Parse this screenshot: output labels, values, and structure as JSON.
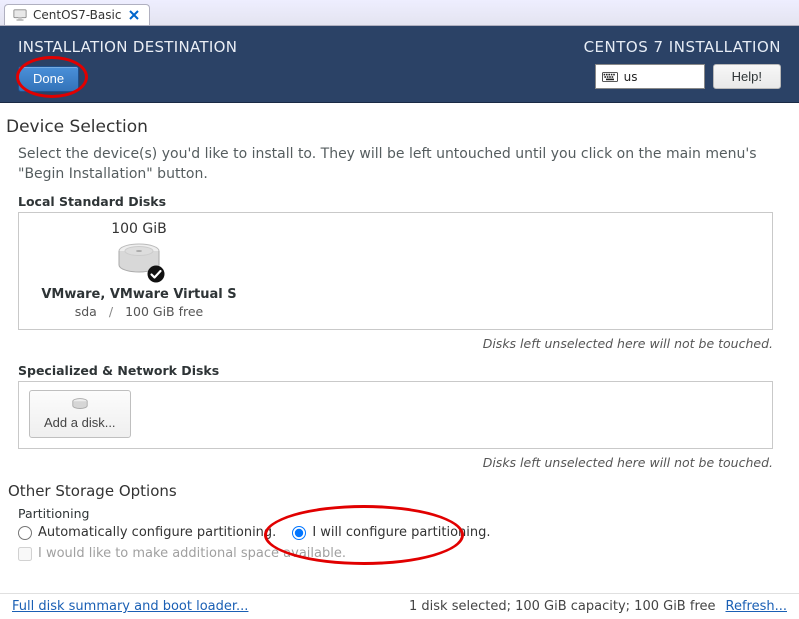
{
  "tab": {
    "title": "CentOS7-Basic"
  },
  "header": {
    "title": "INSTALLATION DESTINATION",
    "done_label": "Done",
    "subtitle": "CENTOS 7 INSTALLATION",
    "keyboard_layout": "us",
    "help_label": "Help!"
  },
  "device_selection": {
    "heading": "Device Selection",
    "intro": "Select the device(s) you'd like to install to.  They will be left untouched until you click on the main menu's \"Begin Installation\" button."
  },
  "local_disks": {
    "label": "Local Standard Disks",
    "disk": {
      "size": "100 GiB",
      "name": "VMware, VMware Virtual S",
      "dev": "sda",
      "free": "100 GiB free"
    },
    "hint": "Disks left unselected here will not be touched."
  },
  "network_disks": {
    "label": "Specialized & Network Disks",
    "add_label": "Add a disk...",
    "hint": "Disks left unselected here will not be touched."
  },
  "storage": {
    "heading": "Other Storage Options",
    "partitioning_label": "Partitioning",
    "auto_label": "Automatically configure partitioning.",
    "manual_label": "I will configure partitioning.",
    "manual_selected": true,
    "additional_space_label": "I would like to make additional space available."
  },
  "footer": {
    "summary_link": "Full disk summary and boot loader...",
    "status": "1 disk selected; 100 GiB capacity; 100 GiB free",
    "refresh_link": "Refresh..."
  }
}
